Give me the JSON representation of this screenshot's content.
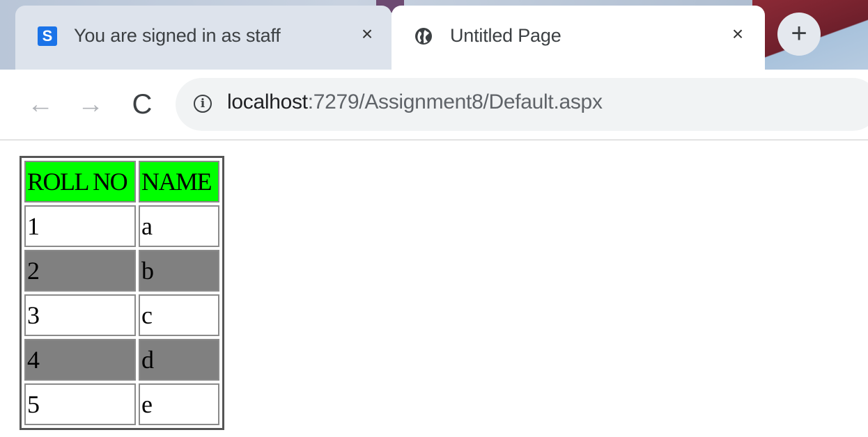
{
  "tabs": [
    {
      "title": "You are signed in as staff",
      "favicon": "S",
      "active": false,
      "close": "×"
    },
    {
      "title": "Untitled Page",
      "active": true,
      "close": "×"
    }
  ],
  "new_tab_label": "+",
  "nav": {
    "back": "←",
    "forward": "→",
    "reload": "C"
  },
  "address": {
    "host": "localhost",
    "path": ":7279/Assignment8/Default.aspx",
    "info_icon": "i"
  },
  "table": {
    "headers": [
      "ROLL NO",
      "NAME"
    ],
    "header_color": "#00ff00",
    "alt_row_color": "#808080",
    "rows": [
      [
        "1",
        "a"
      ],
      [
        "2",
        "b"
      ],
      [
        "3",
        "c"
      ],
      [
        "4",
        "d"
      ],
      [
        "5",
        "e"
      ]
    ]
  }
}
